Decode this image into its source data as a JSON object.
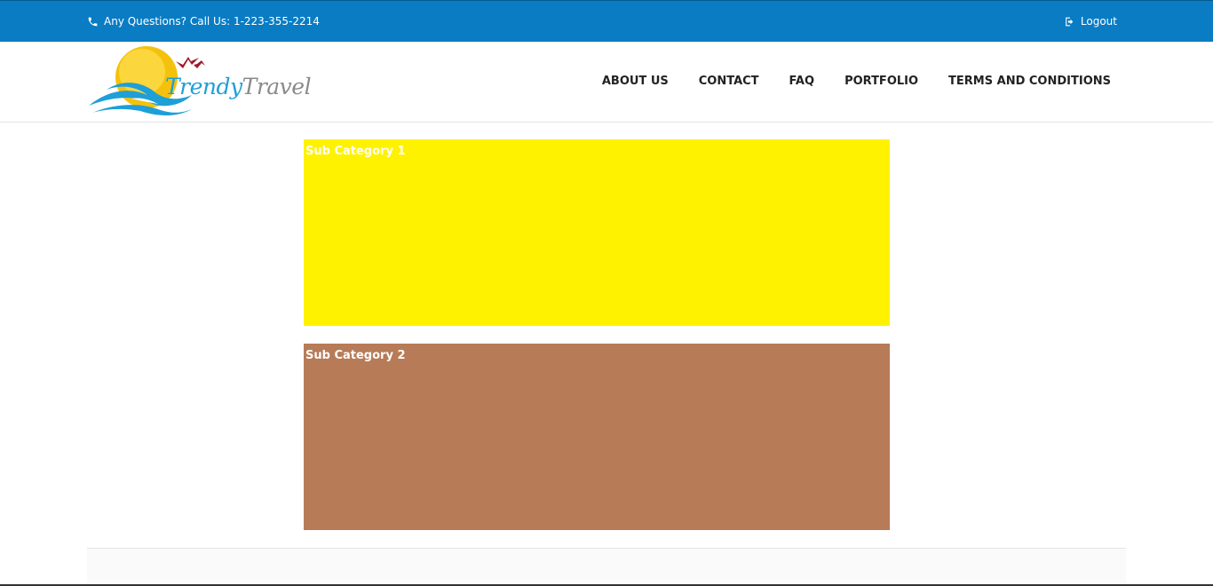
{
  "topbar": {
    "phone_text": "Any Questions? Call Us: 1-223-355-2214",
    "logout_label": "Logout",
    "background_color": "#0a7cc3"
  },
  "header": {
    "logo": {
      "text_part1": "Trendy",
      "text_part2": "Travel"
    },
    "nav": [
      {
        "label": "ABOUT US"
      },
      {
        "label": "CONTACT"
      },
      {
        "label": "FAQ"
      },
      {
        "label": "PORTFOLIO"
      },
      {
        "label": "TERMS AND CONDITIONS"
      }
    ]
  },
  "main": {
    "tiles": [
      {
        "label": "Sub Category 1",
        "color": "#fff200"
      },
      {
        "label": "Sub Category 2",
        "color": "#b77b58"
      }
    ]
  },
  "icons": {
    "phone": "phone-icon",
    "logout": "logout-icon"
  }
}
